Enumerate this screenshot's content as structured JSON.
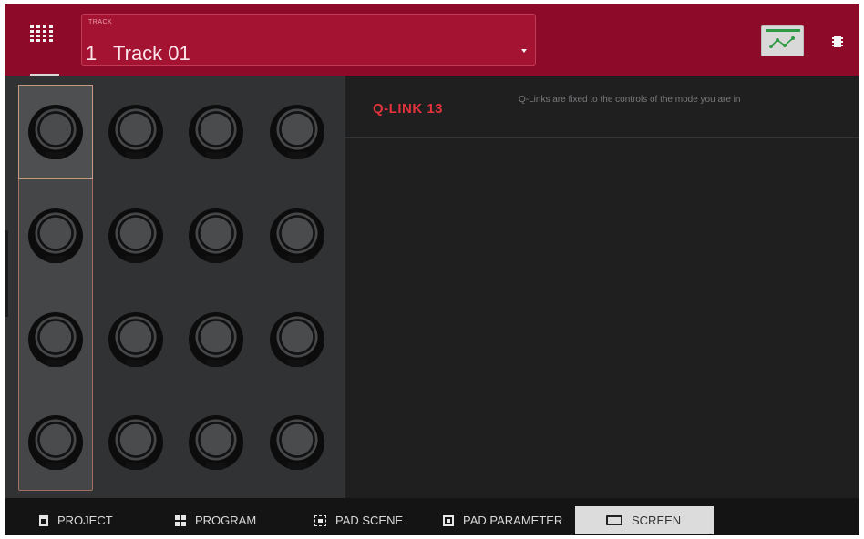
{
  "header": {
    "track_label": "TRACK",
    "track_number": "1",
    "track_name": "Track 01"
  },
  "knobs": {
    "rows": 4,
    "columns": 4,
    "selected_column": 1
  },
  "info": {
    "title": "Q-LINK 13",
    "description": "Q-Links are fixed to the controls of the mode you are in"
  },
  "tabs": [
    {
      "label": "PROJECT",
      "icon": "project-icon"
    },
    {
      "label": "PROGRAM",
      "icon": "program-grid-icon"
    },
    {
      "label": "PAD SCENE",
      "icon": "pad-scene-icon"
    },
    {
      "label": "PAD PARAMETER",
      "icon": "pad-parameter-icon"
    },
    {
      "label": "SCREEN",
      "icon": "screen-icon",
      "active": true
    }
  ],
  "colors": {
    "header_bg": "#8d0b28",
    "accent_red": "#e0333c",
    "automation_green": "#2e9a43"
  }
}
